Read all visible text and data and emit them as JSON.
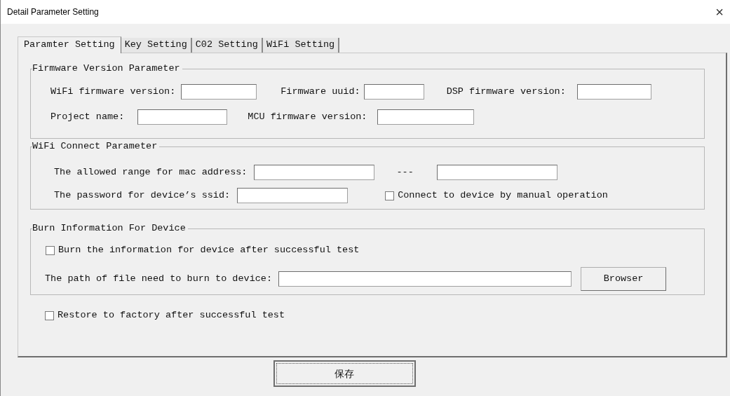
{
  "window": {
    "title": "Detail Parameter Setting",
    "close": "×"
  },
  "tabs": [
    {
      "label": "Paramter Setting",
      "selected": true
    },
    {
      "label": "Key Setting",
      "selected": false
    },
    {
      "label": "C02 Setting",
      "selected": false
    },
    {
      "label": "WiFi Setting",
      "selected": false
    }
  ],
  "groups": [
    {
      "title": "Firmware Version Parameter",
      "rows": [
        [
          {
            "kind": "label",
            "text": "WiFi firmware version:"
          },
          {
            "kind": "field"
          },
          {
            "kind": "label",
            "text": "Firmware uuid:"
          },
          {
            "kind": "field"
          },
          {
            "kind": "label",
            "text": "DSP firmware version:"
          },
          {
            "kind": "field"
          }
        ],
        [
          {
            "kind": "label",
            "text": "Project name:"
          },
          {
            "kind": "field"
          },
          {
            "kind": "label",
            "text": "MCU firmware version:"
          },
          {
            "kind": "field"
          }
        ]
      ]
    },
    {
      "title": "WiFi Connect Parameter",
      "rows": [
        [
          {
            "kind": "label",
            "text": "The allowed range for mac address:"
          },
          {
            "kind": "field"
          },
          {
            "kind": "label",
            "text": "---"
          },
          {
            "kind": "field"
          }
        ],
        [
          {
            "kind": "label",
            "text": "The password for device’s ssid:"
          },
          {
            "kind": "field"
          },
          {
            "kind": "checkbox",
            "text": "Connect to device by manual operation",
            "checked": false
          }
        ]
      ]
    },
    {
      "title": "Burn Information For Device",
      "rows": [
        [
          {
            "kind": "checkbox",
            "text": "Burn the information for device after successful test",
            "checked": false
          }
        ],
        [
          {
            "kind": "label",
            "text": "The path of file need to burn to device:"
          },
          {
            "kind": "field"
          },
          {
            "kind": "button",
            "text": "Browser"
          }
        ]
      ]
    }
  ],
  "restore": {
    "text": "Restore to factory after successful test",
    "checked": false
  },
  "save_button": "保存"
}
